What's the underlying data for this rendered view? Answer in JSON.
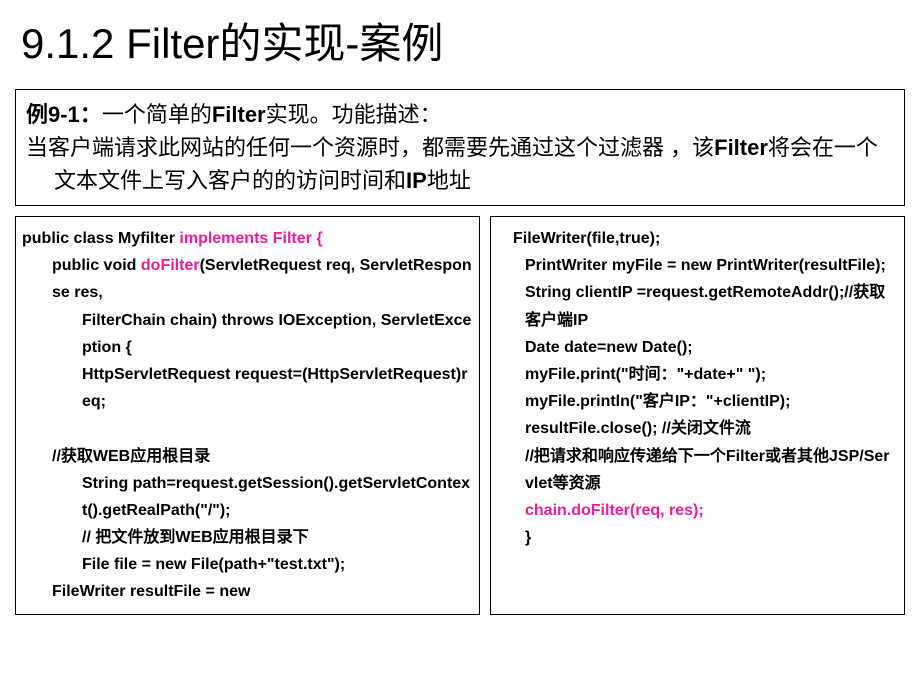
{
  "title": "9.1.2 Filter的实现-案例",
  "description": {
    "line1_prefix": "例9-1：",
    "line1_text": "一个简单的",
    "line1_bold": "Filter",
    "line1_suffix": "实现。功能描述：",
    "line2_part1": "当客户端请求此网站的任何一个资源时，都需要先通过这个过滤器 ，该",
    "line2_bold": "Filter",
    "line2_part2": "将会在一个文本文件上写入客户的的访问时间和",
    "line2_bold2": "IP",
    "line2_part3": "地址"
  },
  "code_left": {
    "l1_a": "public class Myfilter ",
    "l1_b": "implements Filter {",
    "l2_a": "public void ",
    "l2_b": "doFilter",
    "l2_c": "(ServletRequest req, ServletResponse res,",
    "l3": "FilterChain chain) throws IOException, ServletException {",
    "l4": "HttpServletRequest request=(HttpServletRequest)req;",
    "l5": "",
    "l6": "//获取WEB应用根目录",
    "l7": "String path=request.getSession().getServletContext().getRealPath(\"/\");",
    "l8": "// 把文件放到WEB应用根目录下",
    "l9": "File file = new File(path+\"test.txt\");",
    "l10": "FileWriter resultFile = new"
  },
  "code_right": {
    "r1": "FileWriter(file,true);",
    "r2": "PrintWriter myFile = new PrintWriter(resultFile);",
    "r3": "String clientIP =request.getRemoteAddr();//获取客户端IP",
    "r4": "Date date=new Date();",
    "r5": "myFile.print(\"时间：\"+date+\" \");",
    "r6": "myFile.println(\"客户IP：\"+clientIP);",
    "r7": "resultFile.close(); //关闭文件流",
    "r8": "//把请求和响应传递给下一个Filter或者其他JSP/Servlet等资源",
    "r9": "chain.doFilter(req, res);",
    "r10": "}"
  }
}
